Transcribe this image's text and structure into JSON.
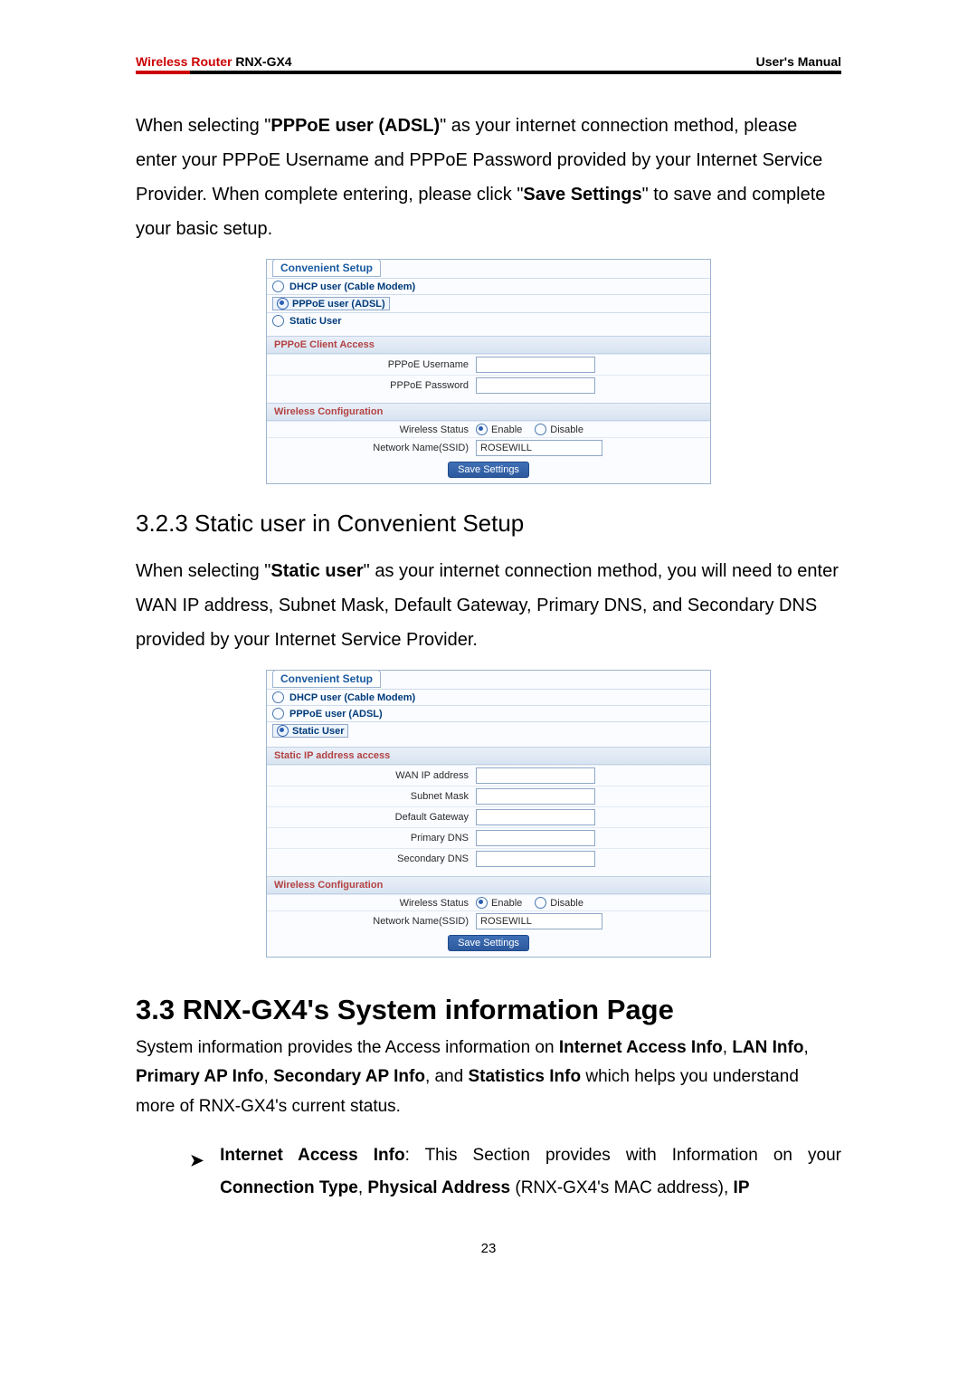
{
  "header": {
    "product": "Wireless Router",
    "model": "RNX-GX4",
    "right": "User's Manual"
  },
  "para1": {
    "pre": "When selecting \"",
    "bold1": "PPPoE user (ADSL)",
    "mid": "\" as your internet connection method, please enter your PPPoE Username and PPPoE Password provided by your Internet Service Provider. When complete entering, please click \"",
    "bold2": "Save Settings",
    "post": "\" to save and complete your basic setup."
  },
  "shot1": {
    "title": "Convenient Setup",
    "opt1": "DHCP user (Cable Modem)",
    "opt2": "PPPoE user (ADSL)",
    "opt3": "Static User",
    "bar1": "PPPoE Client Access",
    "row_user": "PPPoE Username",
    "row_pass": "PPPoE Password",
    "bar2": "Wireless Configuration",
    "row_ws": "Wireless Status",
    "enable": "Enable",
    "disable": "Disable",
    "row_ssid": "Network Name(SSID)",
    "ssid_val": "ROSEWILL",
    "save": "Save Settings"
  },
  "h3": "3.2.3 Static user in Convenient Setup",
  "para2": {
    "pre": "When selecting \"",
    "bold1": "Static user",
    "post": "\" as your internet connection method, you will need to enter WAN IP address, Subnet Mask, Default Gateway, Primary DNS, and Secondary DNS provided by your Internet Service Provider."
  },
  "shot2": {
    "title": "Convenient Setup",
    "opt1": "DHCP user (Cable Modem)",
    "opt2": "PPPoE user (ADSL)",
    "opt3": "Static User",
    "bar1": "Static IP address access",
    "row_wan": "WAN IP address",
    "row_subnet": "Subnet Mask",
    "row_gw": "Default Gateway",
    "row_dns1": "Primary DNS",
    "row_dns2": "Secondary DNS",
    "bar2": "Wireless Configuration",
    "row_ws": "Wireless Status",
    "enable": "Enable",
    "disable": "Disable",
    "row_ssid": "Network Name(SSID)",
    "ssid_val": "ROSEWILL",
    "save": "Save Settings"
  },
  "h2": "3.3 RNX-GX4's System information Page",
  "para3": {
    "t1": "System information provides the Access information on ",
    "b1": "Internet Access Info",
    "t2": ", ",
    "b2": "LAN Info",
    "t3": ", ",
    "b3": "Primary AP Info",
    "t4": ", ",
    "b4": "Secondary AP Info",
    "t5": ", and ",
    "b5": "Statistics Info",
    "t6": " which helps you understand more of RNX-GX4's current status."
  },
  "bullet": {
    "b1": "Internet Access Info",
    "t1": ": This Section provides with Information on your ",
    "b2": "Connection Type",
    "t2": ", ",
    "b3": "Physical Address",
    "t3": " (RNX-GX4's MAC address), ",
    "b4": "IP"
  },
  "pagenum": "23"
}
